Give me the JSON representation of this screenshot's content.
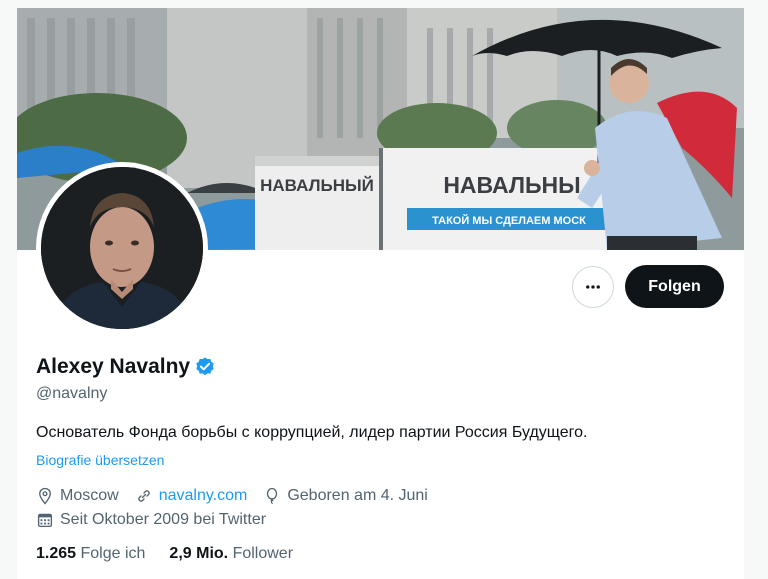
{
  "profile": {
    "name": "Alexey Navalny",
    "handle": "@navalny",
    "bio": "Основатель Фонда борьбы с коррупцией, лидер партии Россия Будущего.",
    "translate_label": "Biografie übersetzen",
    "location": "Moscow",
    "website": "navalny.com",
    "birthday": "Geboren am 4. Juni",
    "joined": "Seit Oktober 2009 bei Twitter",
    "verified": true
  },
  "actions": {
    "follow_label": "Folgen",
    "more_icon": "more-dots-icon"
  },
  "stats": {
    "following_count": "1.265",
    "following_label": "Folge ich",
    "followers_count": "2,9 Mio.",
    "followers_label": "Follower"
  },
  "banner": {
    "sign_left": "НАВАЛЬНЫЙ",
    "sign_right": "НАВАЛЬНЫ",
    "sign_sub": "ТАКОЙ МЫ СДЕЛАЕМ МОСК"
  },
  "colors": {
    "accent": "#1d9bf0",
    "text": "#0f1419",
    "muted": "#536471",
    "button_dark": "#0f1419"
  }
}
